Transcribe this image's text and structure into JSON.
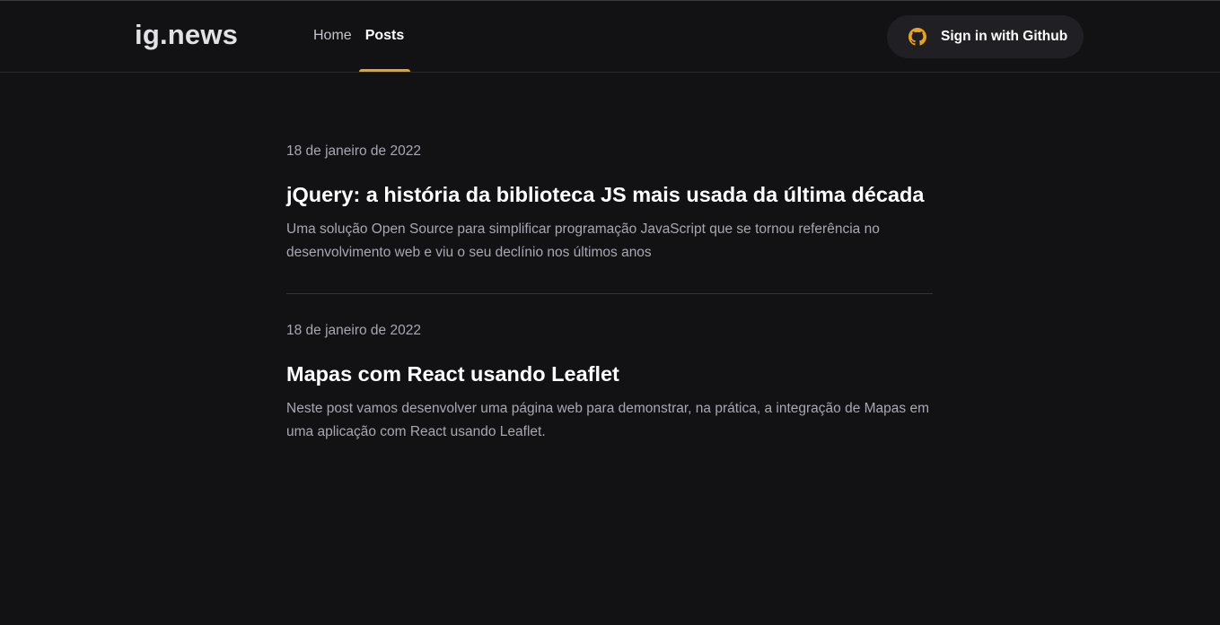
{
  "header": {
    "logo": "ig.news",
    "nav": {
      "home_label": "Home",
      "posts_label": "Posts",
      "active": "Posts"
    },
    "signin": {
      "label": "Sign in with Github",
      "icon": "github-icon"
    }
  },
  "posts": [
    {
      "date": "18 de janeiro de 2022",
      "title": "jQuery: a história da biblioteca JS mais usada da última década",
      "excerpt": "Uma solução Open Source para simplificar programação JavaScript que se tornou referência no desenvolvimento web e viu o seu declínio nos últimos anos"
    },
    {
      "date": "18 de janeiro de 2022",
      "title": "Mapas com React usando Leaflet",
      "excerpt": "Neste post vamos desenvolver uma página web para demonstrar, na prática, a integração de Mapas em uma aplicação com React usando Leaflet."
    }
  ],
  "colors": {
    "background": "#121214",
    "accent": "#eba417",
    "button_bg": "#202024",
    "text_muted": "#a8a8b3"
  }
}
